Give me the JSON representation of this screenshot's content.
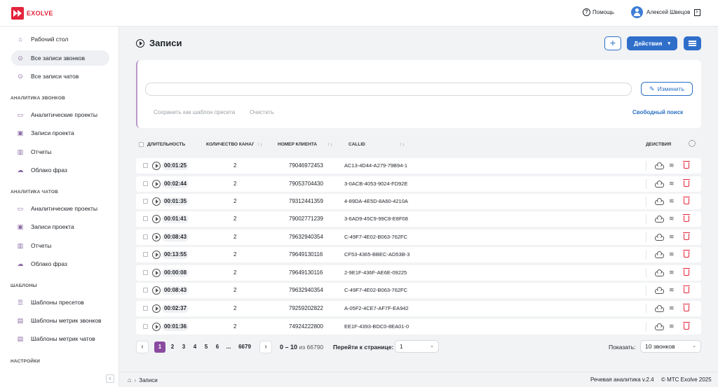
{
  "app": {
    "logo_text": "EXOLVE",
    "help_label": "Помощь",
    "user_name": "Алексей Швецов",
    "brand_color": "#e3243b",
    "accent_color": "#2f6fca"
  },
  "sidebar": {
    "items_top": [
      {
        "label": "Рабочий стол",
        "icon": "home-icon"
      },
      {
        "label": "Все записи звонков",
        "icon": "play-circle-icon",
        "active": true
      },
      {
        "label": "Все записи чатов",
        "icon": "play-circle-icon"
      }
    ],
    "section_calls": "АНАЛИТИКА ЗВОНКОВ",
    "calls_items": [
      {
        "label": "Аналитические проекты",
        "icon": "folder-icon"
      },
      {
        "label": "Записи проекта",
        "icon": "folder-play-icon"
      },
      {
        "label": "Отчеты",
        "icon": "bar-chart-icon"
      },
      {
        "label": "Облако фраз",
        "icon": "cloud-icon"
      }
    ],
    "section_chats": "АНАЛИТИКА ЧАТОВ",
    "chats_items": [
      {
        "label": "Аналитические проекты",
        "icon": "folder-icon"
      },
      {
        "label": "Записи проекта",
        "icon": "folder-play-icon"
      },
      {
        "label": "Отчеты",
        "icon": "bar-chart-icon"
      },
      {
        "label": "Облако фраз",
        "icon": "cloud-icon"
      }
    ],
    "section_templates": "ШАБЛОНЫ",
    "templates_items": [
      {
        "label": "Шаблоны пресетов",
        "icon": "list-icon"
      },
      {
        "label": "Шаблоны метрик звонков",
        "icon": "document-icon"
      },
      {
        "label": "Шаблоны метрик чатов",
        "icon": "document-icon"
      }
    ],
    "section_settings": "НАСТРОЙКИ",
    "collapse": "‹"
  },
  "header": {
    "title": "Записи",
    "plus": "+",
    "actions_label": "Действия",
    "chevron": "⌄"
  },
  "filter": {
    "search_value": "",
    "edit_label": "Изменить",
    "save_preset": "Сохранить как шаблон пресета",
    "clear": "Очистить",
    "free_search": "Свободный поиск"
  },
  "table": {
    "col_duration": "ДЛИТЕЛЬНОСТЬ",
    "col_channels": "КОЛИЧЕСТВО КАНАЛОВ",
    "col_phone": "НОМЕР КЛИЕНТА",
    "col_callid": "CALLID",
    "col_actions": "ДЕЙСТВИЯ",
    "sort_glyph": "↑↓",
    "rows": [
      {
        "duration": "00:01:25",
        "channels": "2",
        "phone": "79046972453",
        "callid": "1-AC13-4D44-A279-79B94"
      },
      {
        "duration": "00:02:44",
        "channels": "2",
        "phone": "79053704430",
        "callid": "3-0ACB-4053-9024-FD92E"
      },
      {
        "duration": "00:01:35",
        "channels": "2",
        "phone": "79312441359",
        "callid": "4-89DA-4E5D-8A60-4210A"
      },
      {
        "duration": "00:01:41",
        "channels": "2",
        "phone": "79002771239",
        "callid": "3-6AD9-45C9-99C8-E8F08"
      },
      {
        "duration": "00:08:43",
        "channels": "2",
        "phone": "79632940354",
        "callid": "C-49F7-4E02-B063-762FC"
      },
      {
        "duration": "00:13:55",
        "channels": "2",
        "phone": "79649130116",
        "callid": "3-CF53-4365-BBEC-AD53B"
      },
      {
        "duration": "00:00:08",
        "channels": "2",
        "phone": "79649130116",
        "callid": "2-9E1F-436F-AE6E-09225"
      },
      {
        "duration": "00:08:43",
        "channels": "2",
        "phone": "79632940354",
        "callid": "C-49F7-4E02-B063-762FC"
      },
      {
        "duration": "00:02:37",
        "channels": "2",
        "phone": "79259202822",
        "callid": "A-05F2-4CE7-AF7F-EA942"
      },
      {
        "duration": "00:01:36",
        "channels": "2",
        "phone": "74924222800",
        "callid": "0-EE1F-4393-BDC0-8EA01"
      }
    ]
  },
  "pagination": {
    "prev": "‹",
    "next": "›",
    "pages": [
      "1",
      "2",
      "3",
      "4",
      "5",
      "6",
      "...",
      "6679"
    ],
    "current_page": "1",
    "range": "0 – 10",
    "of_total": "из 66790",
    "goto_label": "Перейти к странице:",
    "goto_value": "1",
    "show_label": "Показать:",
    "per_page": "10 звонков"
  },
  "footer": {
    "breadcrumb": "Записи",
    "breadcrumb_sep": "›",
    "version": "Речевая аналитика v.2.4",
    "copyright": "© МТС Exolve 2025"
  }
}
